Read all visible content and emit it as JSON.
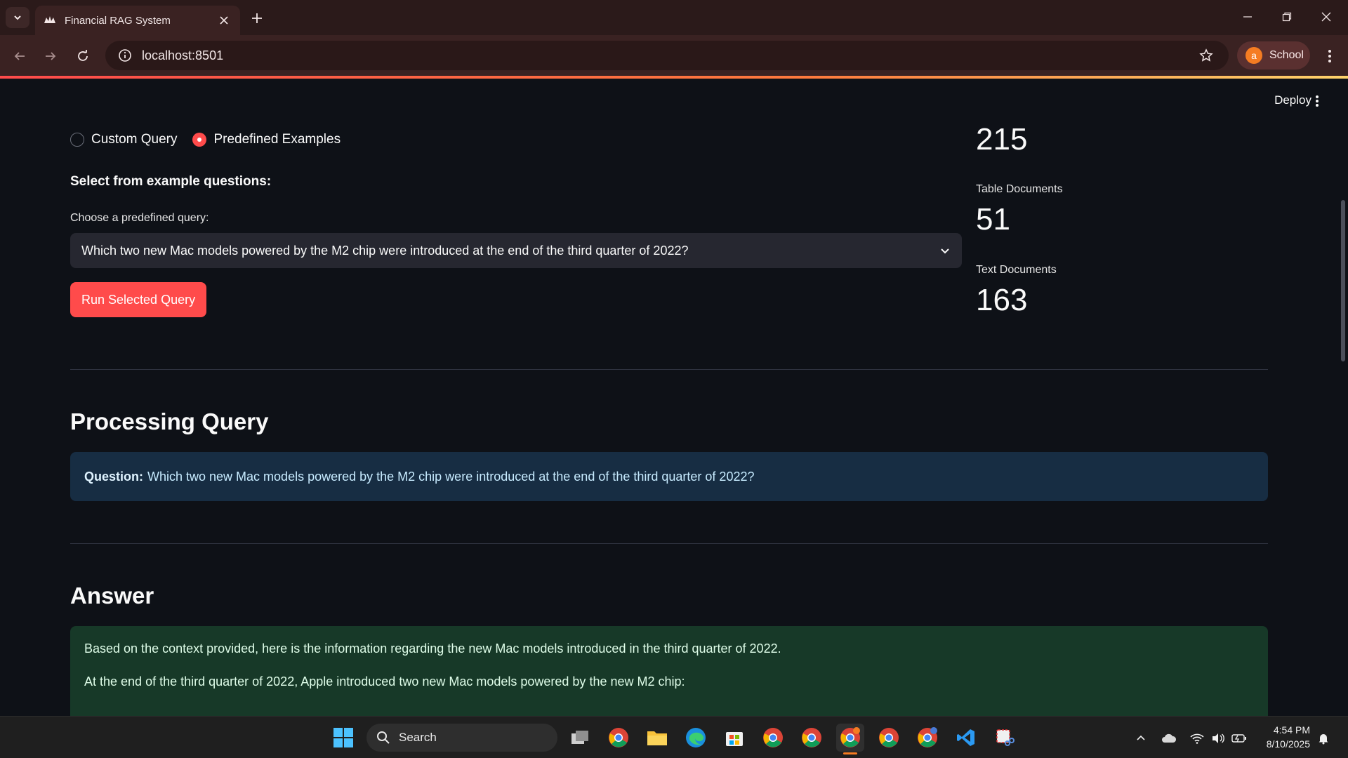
{
  "browser": {
    "tab_title": "Financial RAG System",
    "url": "localhost:8501",
    "profile_initial": "a",
    "profile_label": "School"
  },
  "app": {
    "deploy_label": "Deploy",
    "mode_options": [
      {
        "label": "Custom Query",
        "selected": false
      },
      {
        "label": "Predefined Examples",
        "selected": true
      }
    ],
    "examples_heading": "Select from example questions:",
    "select_label": "Choose a predefined query:",
    "selected_query": "Which two new Mac models powered by the M2 chip were introduced at the end of the third quarter of 2022?",
    "run_button": "Run Selected Query",
    "metrics": {
      "top_value": "215",
      "table_label": "Table Documents",
      "table_value": "51",
      "text_label": "Text Documents",
      "text_value": "163"
    },
    "processing_heading": "Processing Query",
    "question_label": "Question:",
    "question_text": "Which two new Mac models powered by the M2 chip were introduced at the end of the third quarter of 2022?",
    "answer_heading": "Answer",
    "answer_paragraphs": [
      "Based on the context provided, here is the information regarding the new Mac models introduced in the third quarter of 2022.",
      "At the end of the third quarter of 2022, Apple introduced two new Mac models powered by the new M2 chip:"
    ],
    "accent_color": "#ff4b4b",
    "info_color": "#172d43",
    "success_color": "#173928"
  },
  "taskbar": {
    "search_label": "Search",
    "time": "4:54 PM",
    "date": "8/10/2025",
    "icons": [
      "windows-start-icon",
      "search-icon",
      "task-view-icon",
      "chrome-icon",
      "file-explorer-icon",
      "edge-icon",
      "store-icon",
      "chrome-icon",
      "chrome-icon",
      "chrome-icon",
      "chrome-icon",
      "chrome-icon",
      "vscode-icon",
      "snipping-tool-icon"
    ]
  }
}
